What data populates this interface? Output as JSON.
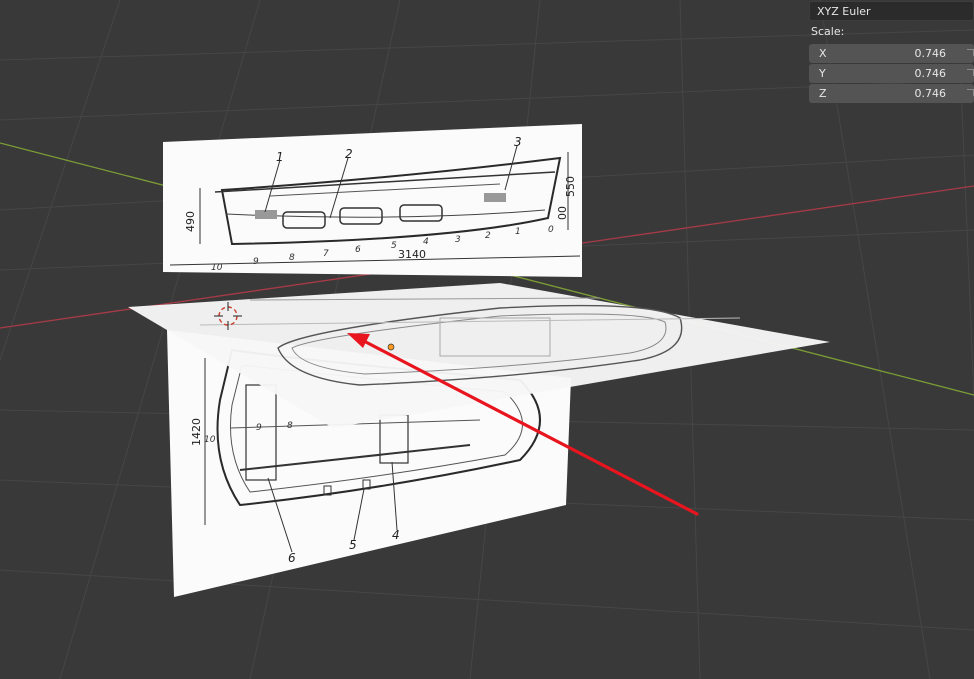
{
  "properties": {
    "rotation_mode": "XYZ Euler",
    "scale_label": "Scale:",
    "scale": [
      {
        "axis": "X",
        "value": "0.746"
      },
      {
        "axis": "Y",
        "value": "0.746"
      },
      {
        "axis": "Z",
        "value": "0.746"
      }
    ]
  },
  "side_drawing": {
    "callouts": [
      "1",
      "2",
      "3"
    ],
    "stations": [
      "10",
      "9",
      "8",
      "7",
      "6",
      "5",
      "4",
      "3",
      "2",
      "1",
      "0"
    ],
    "dims": [
      "490",
      "550",
      "00",
      "3140"
    ]
  },
  "plan_drawing": {
    "callouts": [
      "6",
      "5",
      "4"
    ],
    "dims": [
      "1420",
      "10",
      "8",
      "9"
    ]
  },
  "colors": {
    "background": "#393939",
    "x_axis": "#a83a48",
    "y_axis": "#7c9d35",
    "arrow": "#e8141e",
    "origin": "#ff9a1f"
  }
}
